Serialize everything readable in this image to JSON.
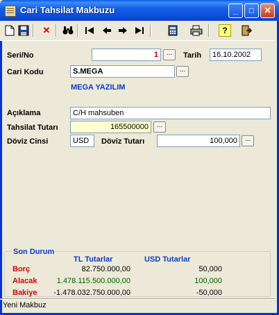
{
  "window": {
    "title": "Cari Tahsilat Makbuzu",
    "minimize": "_",
    "maximize": "□",
    "close": "✕"
  },
  "toolbar": {
    "icons": [
      "new-icon",
      "save-icon",
      "delete-icon",
      "search-icon",
      "first-icon",
      "previous-icon",
      "next-icon",
      "last-icon",
      "calculator-icon",
      "print-icon",
      "help-icon",
      "exit-icon"
    ],
    "glyphs": {
      "delete": "✕",
      "search": "⌕",
      "first": "|◀",
      "previous": "◀",
      "next": "▶",
      "last": "▶|",
      "help": "?"
    }
  },
  "form": {
    "seri_no_label": "Seri/No",
    "seri_no_value": "1",
    "tarih_label": "Tarih",
    "tarih_value": "16.10.2002",
    "cari_kodu_label": "Cari Kodu",
    "cari_kodu_value": "S.MEGA",
    "company_name": "MEGA YAZILIM",
    "aciklama_label": "Açıklama",
    "aciklama_value": "C/H mahsuben",
    "tahsilat_tutari_label": "Tahsilat Tutarı",
    "tahsilat_tutari_value": "165500000",
    "doviz_cinsi_label": "Döviz Cinsi",
    "doviz_cinsi_value": "USD",
    "doviz_tutari_label": "Döviz Tutarı",
    "doviz_tutari_value": "100,000",
    "lookup_button": "..."
  },
  "summary": {
    "title": "Son Durum",
    "col_tl": "TL Tutarlar",
    "col_usd": "USD Tutarlar",
    "rows": [
      {
        "label": "Borç",
        "tl": "82.750.000,00",
        "usd": "50,000"
      },
      {
        "label": "Alacak",
        "tl": "1.478.115.500.000,00",
        "usd": "100,000"
      },
      {
        "label": "Bakiye",
        "tl": "-1.478.032.750.000,00",
        "usd": "-50,000"
      }
    ],
    "colors": {
      "borc": "#000000",
      "alacak": "#006000",
      "bakiye": "#000000"
    }
  },
  "status": {
    "text": "Yeni Makbuz"
  }
}
